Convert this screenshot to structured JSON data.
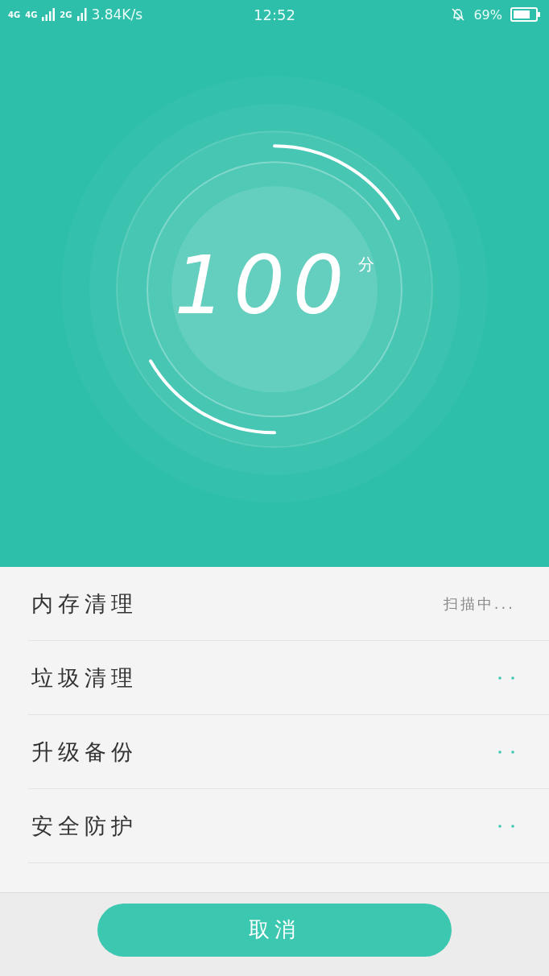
{
  "status_bar": {
    "network_labels": [
      "4G",
      "4G",
      "2G"
    ],
    "speed": "3.84K/s",
    "time": "12:52",
    "battery": "69%"
  },
  "score": {
    "value": "100",
    "unit": "分"
  },
  "items": [
    {
      "label": "内存清理",
      "kind": "scanning",
      "status": "扫描中..."
    },
    {
      "label": "垃圾清理",
      "kind": "pending"
    },
    {
      "label": "升级备份",
      "kind": "pending"
    },
    {
      "label": "安全防护",
      "kind": "pending"
    }
  ],
  "button": "取消"
}
